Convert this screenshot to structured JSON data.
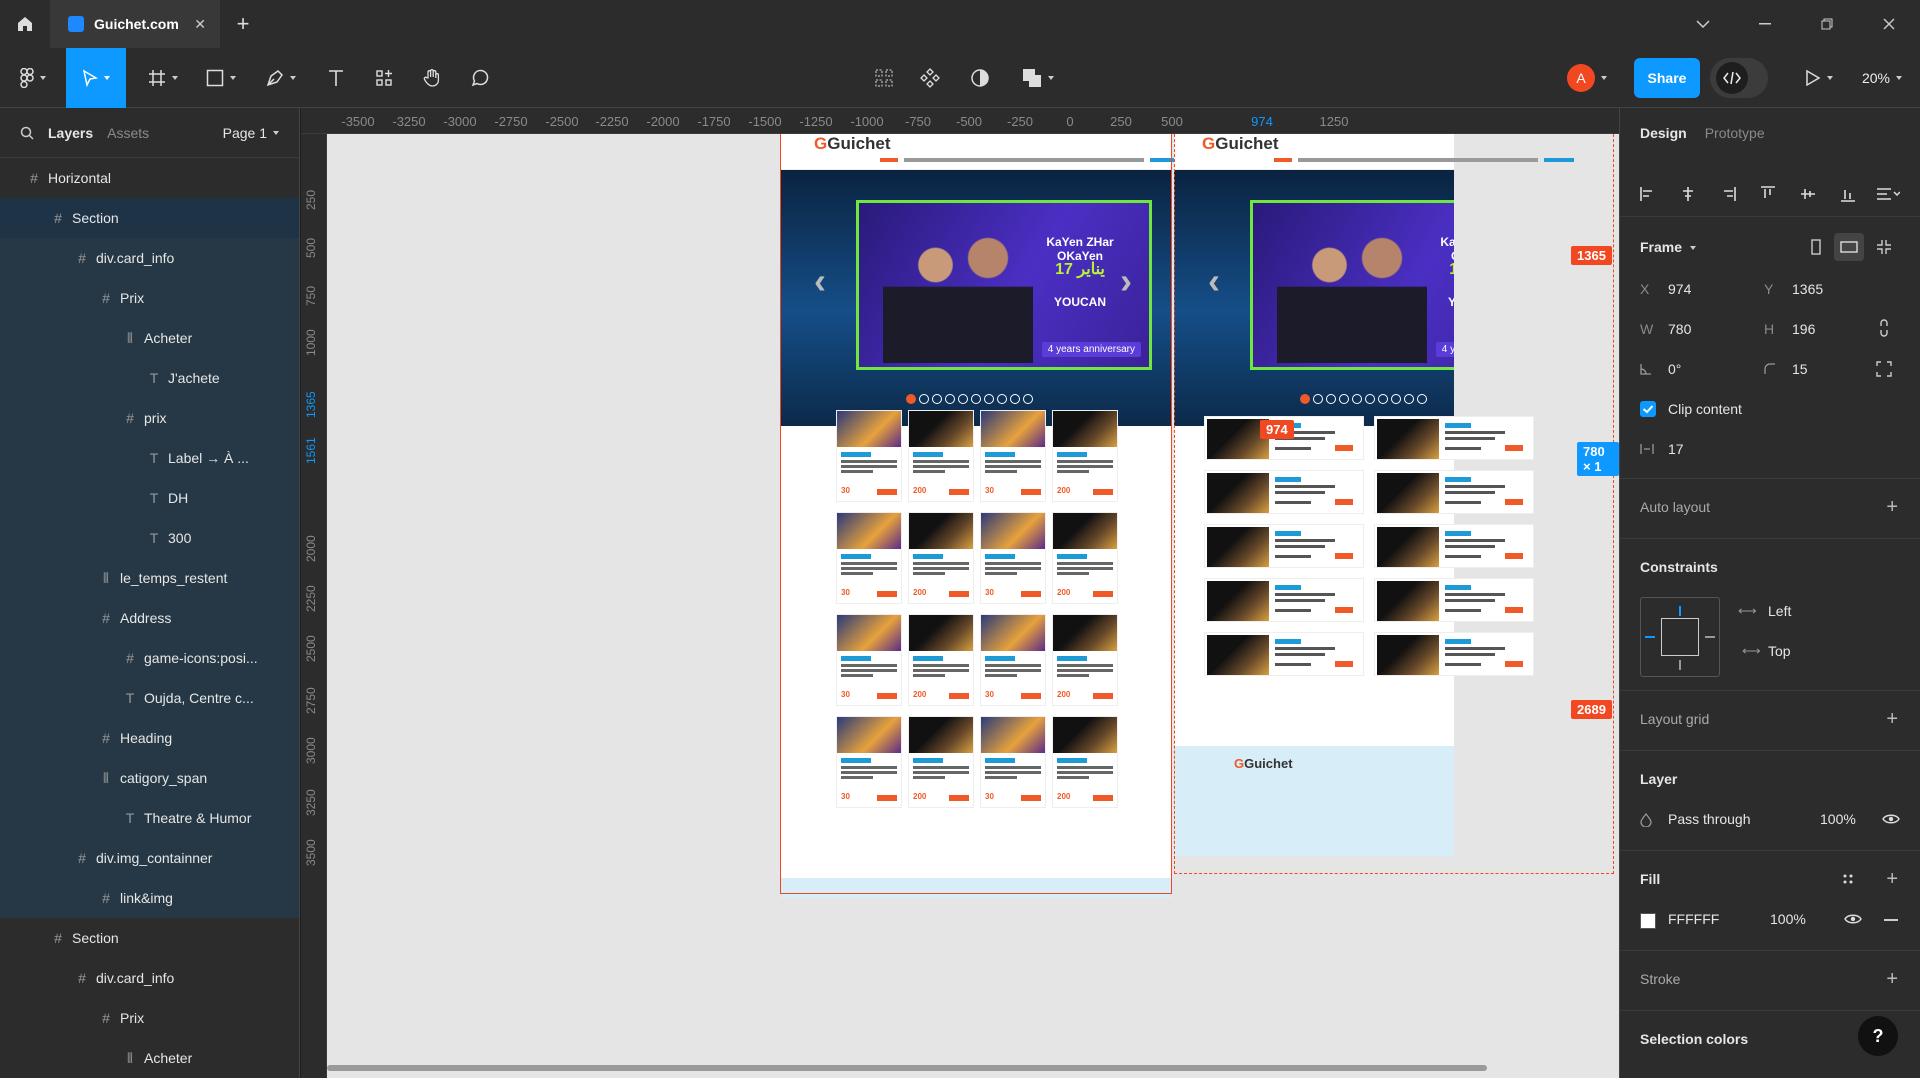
{
  "titlebar": {
    "tab_title": "Guichet.com",
    "close_glyph": "✕",
    "new_tab_glyph": "+"
  },
  "toolbar": {
    "avatar_initial": "A",
    "share_label": "Share",
    "zoom_label": "20%"
  },
  "left_panel": {
    "tabs": [
      "Layers",
      "Assets"
    ],
    "page_label": "Page 1",
    "layers": [
      {
        "icon": "frame-icon",
        "glyph": "#",
        "name": "Horizontal"
      },
      {
        "icon": "frame-icon",
        "glyph": "#",
        "name": "Section"
      },
      {
        "icon": "frame-icon",
        "glyph": "#",
        "name": "div.card_info"
      },
      {
        "icon": "frame-icon",
        "glyph": "#",
        "name": "Prix"
      },
      {
        "icon": "auto-layout-icon",
        "glyph": "⫴",
        "name": "Acheter"
      },
      {
        "icon": "text-icon",
        "glyph": "T",
        "name": "J'achete"
      },
      {
        "icon": "frame-icon",
        "glyph": "#",
        "name": "prix"
      },
      {
        "icon": "text-icon",
        "glyph": "T",
        "name": "Label → À ..."
      },
      {
        "icon": "text-icon",
        "glyph": "T",
        "name": "DH"
      },
      {
        "icon": "text-icon",
        "glyph": "T",
        "name": "300"
      },
      {
        "icon": "auto-layout-icon",
        "glyph": "⫴",
        "name": "le_temps_restent"
      },
      {
        "icon": "frame-icon",
        "glyph": "#",
        "name": "Address"
      },
      {
        "icon": "frame-icon",
        "glyph": "#",
        "name": "game-icons:posi..."
      },
      {
        "icon": "text-icon",
        "glyph": "T",
        "name": "Oujda, Centre c..."
      },
      {
        "icon": "frame-icon",
        "glyph": "#",
        "name": "Heading"
      },
      {
        "icon": "auto-layout-icon",
        "glyph": "⫴",
        "name": "catigory_span"
      },
      {
        "icon": "text-icon",
        "glyph": "T",
        "name": "Theatre & Humor"
      },
      {
        "icon": "frame-icon",
        "glyph": "#",
        "name": "div.img_containner"
      },
      {
        "icon": "frame-icon",
        "glyph": "#",
        "name": "link&img"
      },
      {
        "icon": "frame-icon",
        "glyph": "#",
        "name": "Section"
      },
      {
        "icon": "frame-icon",
        "glyph": "#",
        "name": "div.card_info"
      },
      {
        "icon": "frame-icon",
        "glyph": "#",
        "name": "Prix"
      },
      {
        "icon": "auto-layout-icon",
        "glyph": "⫴",
        "name": "Acheter"
      }
    ]
  },
  "rulers": {
    "top": [
      "-3500",
      "-3250",
      "-3000",
      "-2750",
      "-2500",
      "-2250",
      "-2000",
      "-1750",
      "-1500",
      "-1250",
      "-1000",
      "-750",
      "-500",
      "-250",
      "0",
      "250",
      "500",
      "974",
      "1250"
    ],
    "left": [
      "250",
      "500",
      "750",
      "1000",
      "1365",
      "1561",
      "2000",
      "2250",
      "2500",
      "2750",
      "3000",
      "3250",
      "3500"
    ]
  },
  "canvas": {
    "site_logo": "Guichet",
    "banner_title": "KaYen ZHar OKaYen",
    "banner_date": "17 يناير",
    "banner_brand": "YOUCAN",
    "banner_anniv": "4 years anniversary",
    "card_price": "30",
    "card_price_alt": "200",
    "badges": {
      "x": "974",
      "y_top": "1365",
      "size": "780 × 1",
      "y_bottom": "2689"
    }
  },
  "right_panel": {
    "tabs": [
      "Design",
      "Prototype"
    ],
    "frame": {
      "title": "Frame",
      "x_label": "X",
      "x": "974",
      "y_label": "Y",
      "y": "1365",
      "w_label": "W",
      "w": "780",
      "h_label": "H",
      "h": "196",
      "rotation": "0°",
      "radius": "15",
      "clip_label": "Clip content",
      "spacing": "17"
    },
    "auto_layout": "Auto layout",
    "constraints": {
      "title": "Constraints",
      "horizontal": "Left",
      "vertical": "Top"
    },
    "layout_grid": "Layout grid",
    "layer": {
      "title": "Layer",
      "blend": "Pass through",
      "opacity": "100%"
    },
    "fill": {
      "title": "Fill",
      "hex": "FFFFFF",
      "opacity": "100%"
    },
    "stroke": "Stroke",
    "selection_colors": "Selection colors",
    "help": "?"
  }
}
